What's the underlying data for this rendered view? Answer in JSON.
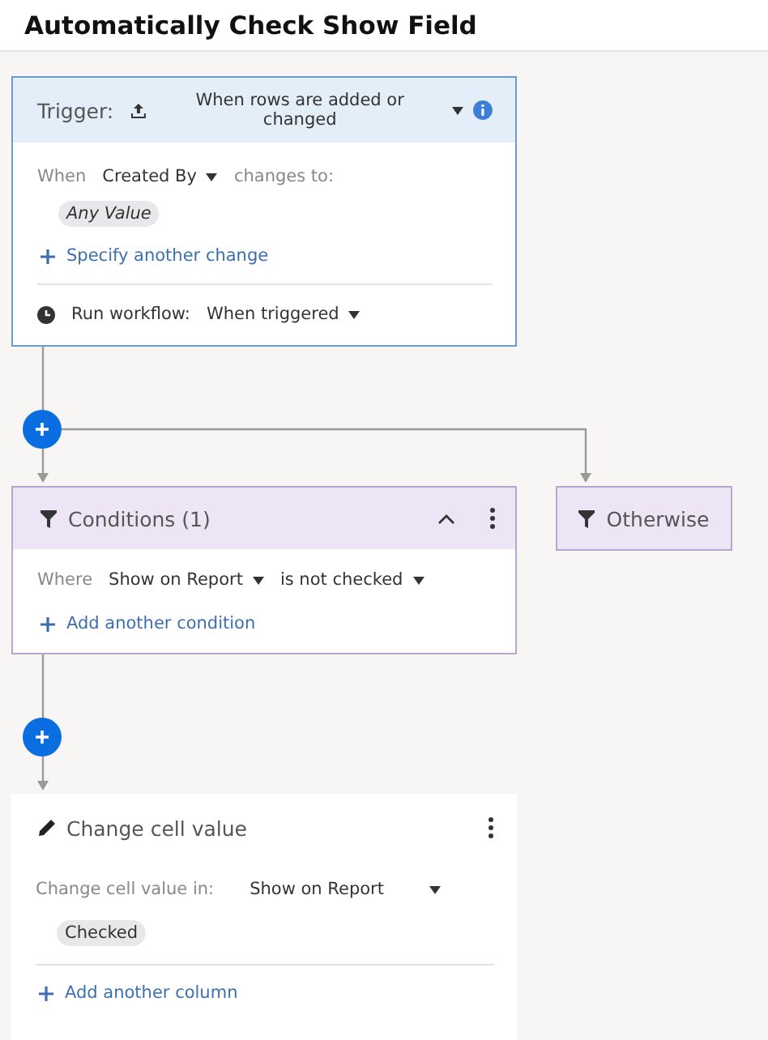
{
  "title": "Automatically Check Show Field",
  "trigger": {
    "label": "Trigger:",
    "event": "When rows are added or changed",
    "when_label": "When",
    "field": "Created By",
    "changes_label": "changes to:",
    "value_chip": "Any Value",
    "add_link": "Specify another change",
    "run_label": "Run workflow:",
    "run_value": "When triggered"
  },
  "conditions": {
    "title": "Conditions (1)",
    "where_label": "Where",
    "field": "Show on Report",
    "operator": "is not checked",
    "add_link": "Add another condition"
  },
  "otherwise": {
    "label": "Otherwise"
  },
  "action": {
    "title": "Change cell value",
    "in_label": "Change cell value in:",
    "column": "Show on Report",
    "value_chip": "Checked",
    "add_link": "Add another column"
  }
}
